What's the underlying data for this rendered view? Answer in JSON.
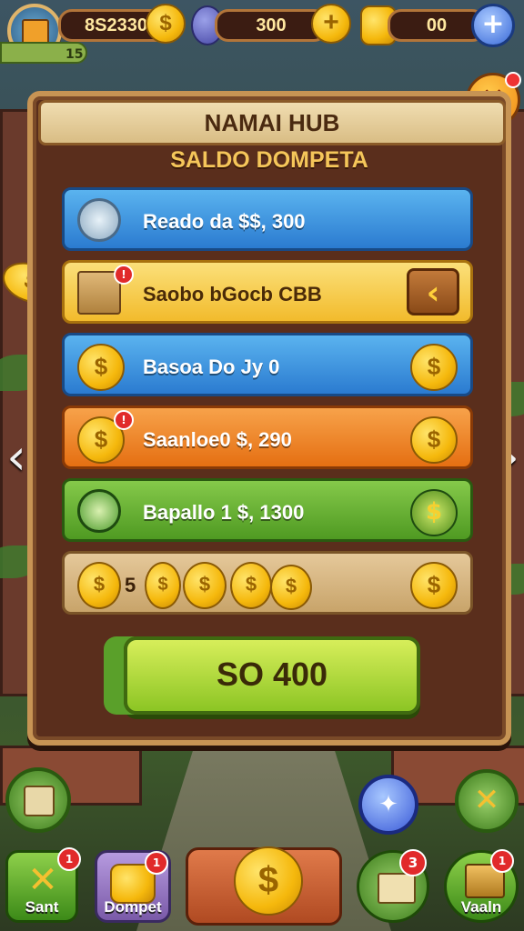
{
  "topbar": {
    "gold_value": "8S2330",
    "gems_value": "300",
    "coins_value": "00",
    "level_text": "15"
  },
  "panel": {
    "title": "NAMAI HUB",
    "subtitle": "SALDO DOMPETA",
    "rows": [
      {
        "label": "Reado da $$, 300",
        "icon": "gear-icon"
      },
      {
        "label": "Saobo bGocb CBB",
        "icon": "treasure-box-icon",
        "button_icon": "back-arrow-icon"
      },
      {
        "label": "Basoa Do Jy 0",
        "icon": "coin-icon"
      },
      {
        "label": "Saanloe0 $, 290",
        "icon": "coin-icon"
      },
      {
        "label": "Bapallo 1 $, 1300",
        "icon": "gift-icon"
      },
      {
        "label": "5",
        "icon": "coin-icon"
      }
    ],
    "action_button": "SO 400"
  },
  "bottom_nav": {
    "items": [
      {
        "label": "Sant",
        "badge": "1"
      },
      {
        "label": "Dompet",
        "badge": "1"
      },
      {
        "label": "",
        "icon": "dollar-coin-icon"
      },
      {
        "label": "",
        "badge": "3"
      },
      {
        "label": "Vaaln",
        "badge": "1"
      }
    ]
  },
  "icons": {
    "coin_symbol": "$",
    "plus_symbol": "+",
    "close_symbol": "✕",
    "left_arrow": "‹",
    "right_arrow": "›"
  },
  "colors": {
    "panel_bg": "#5a2e1c",
    "panel_border": "#c79454",
    "blue_row": "#2b7bd0",
    "yellow_row": "#f2bb2c",
    "orange_row": "#e56f12",
    "green_row": "#4f9a22",
    "action_button": "#8cc524"
  }
}
